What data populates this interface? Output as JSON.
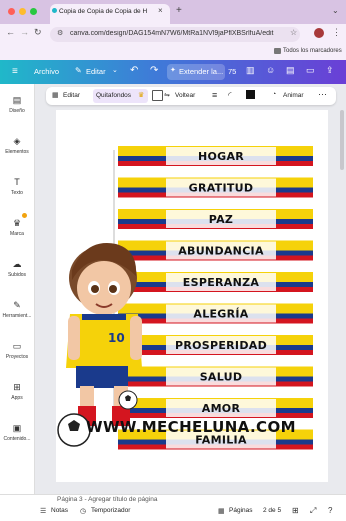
{
  "browser": {
    "tab_title": "Copia de Copia de Copia de H",
    "url": "canva.com/design/DAG154mN7W6/MtRa1NVl9jaPflXBSrlfuA/edit",
    "bookmarks_label": "Todos los marcadores"
  },
  "canva_bar": {
    "file_label": "Archivo",
    "edit_label": "Editar",
    "extend_label": "Extender la...",
    "zoom_label": "75"
  },
  "sidebar": {
    "items": [
      {
        "label": "Diseño",
        "icon": "layout-icon"
      },
      {
        "label": "Elementos",
        "icon": "shapes-icon"
      },
      {
        "label": "Texto",
        "icon": "text-icon"
      },
      {
        "label": "Marca",
        "icon": "crown-icon"
      },
      {
        "label": "Subidos",
        "icon": "cloud-upload-icon"
      },
      {
        "label": "Herramient...",
        "icon": "tools-icon"
      },
      {
        "label": "Proyectos",
        "icon": "folder-icon"
      },
      {
        "label": "Apps",
        "icon": "apps-icon"
      },
      {
        "label": "Contenido...",
        "icon": "photo-icon"
      }
    ]
  },
  "context_toolbar": {
    "edit_label": "Editar",
    "remove_bg_label": "Quitafondos",
    "flip_label": "Voltear",
    "animate_label": "Animar"
  },
  "design": {
    "banners": [
      "HOGAR",
      "GRATITUD",
      "PAZ",
      "ABUNDANCIA",
      "ESPERANZA",
      "ALEGRÍA",
      "PROSPERIDAD",
      "SALUD",
      "AMOR",
      "FAMILIA"
    ],
    "watermark": "WWW.MECHELUNA.COM",
    "jersey_number": "10"
  },
  "bottom_bar": {
    "page_caption": "Página 3 - Agregar título de página",
    "notes_label": "Notas",
    "timer_label": "Temporizador",
    "pages_label": "Páginas",
    "page_count": "2 de 5"
  },
  "colors": {
    "yellow": "#f5d20a",
    "blue": "#1a3a8c",
    "red": "#d4151f",
    "brand_purple": "#7d2ae8"
  }
}
